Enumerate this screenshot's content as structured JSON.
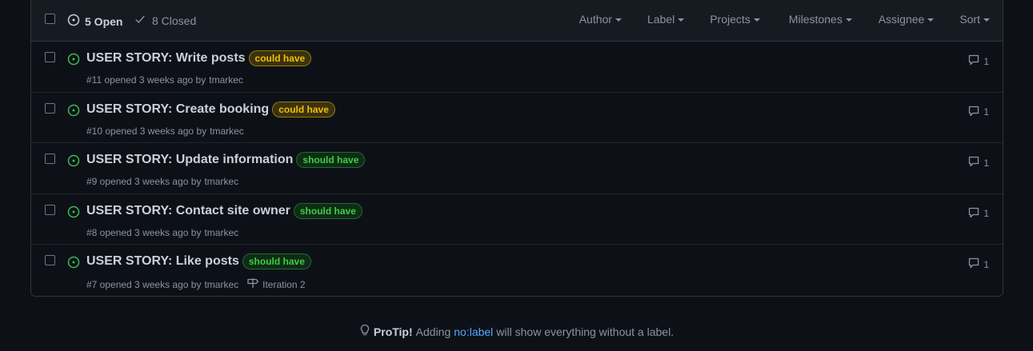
{
  "header": {
    "open_label": "5 Open",
    "closed_label": "8 Closed",
    "filters": [
      {
        "label": "Author"
      },
      {
        "label": "Label"
      },
      {
        "label": "Projects"
      },
      {
        "label": "Milestones"
      },
      {
        "label": "Assignee"
      },
      {
        "label": "Sort"
      }
    ]
  },
  "issues": [
    {
      "title": "USER STORY: Write posts",
      "label": "could have",
      "label_kind": "could",
      "meta": "#11 opened 3 weeks ago by",
      "author": "tmarkec",
      "milestone": "",
      "comments": "1"
    },
    {
      "title": "USER STORY: Create booking",
      "label": "could have",
      "label_kind": "could",
      "meta": "#10 opened 3 weeks ago by",
      "author": "tmarkec",
      "milestone": "",
      "comments": "1"
    },
    {
      "title": "USER STORY: Update information",
      "label": "should have",
      "label_kind": "should",
      "meta": "#9 opened 3 weeks ago by",
      "author": "tmarkec",
      "milestone": "",
      "comments": "1"
    },
    {
      "title": "USER STORY: Contact site owner",
      "label": "should have",
      "label_kind": "should",
      "meta": "#8 opened 3 weeks ago by",
      "author": "tmarkec",
      "milestone": "",
      "comments": "1"
    },
    {
      "title": "USER STORY: Like posts",
      "label": "should have",
      "label_kind": "should",
      "meta": "#7 opened 3 weeks ago by",
      "author": "tmarkec",
      "milestone": "Iteration 2",
      "comments": "1"
    }
  ],
  "protip": {
    "title": "ProTip!",
    "before": "Adding",
    "link": "no:label",
    "after": "will show everything without a label."
  },
  "icons": {
    "open": "issue-opened-icon",
    "closed": "check-icon",
    "comment": "comment-icon",
    "milestone": "milestone-icon",
    "tip": "light-bulb-icon"
  },
  "colors": {
    "background": "#0d1117",
    "open_green": "#3fb950",
    "link_blue": "#58a6ff",
    "could_label": "#f0c000",
    "should_label": "#3fce3f"
  }
}
